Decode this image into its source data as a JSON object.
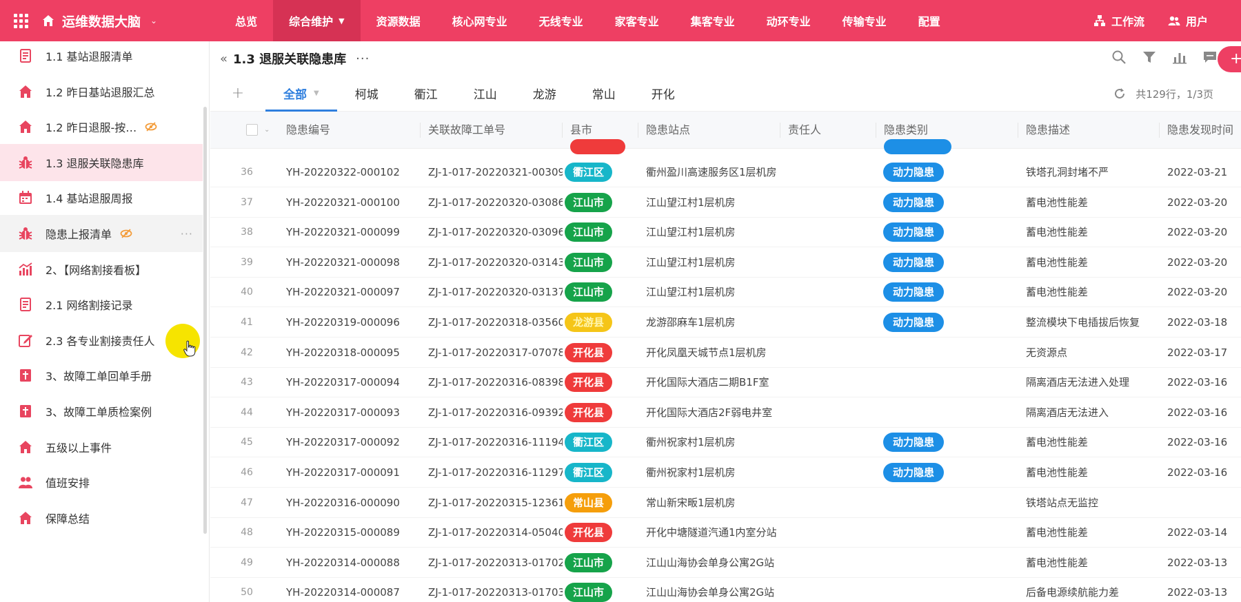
{
  "topbar": {
    "app_title": "运维数据大脑",
    "nav": [
      {
        "label": "总览",
        "active": false,
        "dropdown": false
      },
      {
        "label": "综合维护",
        "active": true,
        "dropdown": true
      },
      {
        "label": "资源数据",
        "active": false,
        "dropdown": false
      },
      {
        "label": "核心网专业",
        "active": false,
        "dropdown": false
      },
      {
        "label": "无线专业",
        "active": false,
        "dropdown": false
      },
      {
        "label": "家客专业",
        "active": false,
        "dropdown": false
      },
      {
        "label": "集客专业",
        "active": false,
        "dropdown": false
      },
      {
        "label": "动环专业",
        "active": false,
        "dropdown": false
      },
      {
        "label": "传输专业",
        "active": false,
        "dropdown": false
      },
      {
        "label": "配置",
        "active": false,
        "dropdown": false
      }
    ],
    "workflow_label": "工作流",
    "user_label": "用户",
    "brand_color": "#ee3f63"
  },
  "sidebar": {
    "items": [
      {
        "label": "1.1 基站退服清单",
        "icon": "report-icon",
        "state": "normal",
        "hidden": false
      },
      {
        "label": "1.2 昨日基站退服汇总",
        "icon": "home-icon",
        "state": "normal",
        "hidden": false
      },
      {
        "label": "1.2 昨日退服-按…",
        "icon": "home-icon",
        "state": "normal",
        "hidden": true
      },
      {
        "label": "1.3 退服关联隐患库",
        "icon": "bug-icon",
        "state": "active",
        "hidden": false
      },
      {
        "label": "1.4 基站退服周报",
        "icon": "calendar-icon",
        "state": "normal",
        "hidden": false
      },
      {
        "label": "隐患上报清单",
        "icon": "bug-icon",
        "state": "hover",
        "hidden": true
      },
      {
        "label": "2、【网络割接看板】",
        "icon": "bar-chart-icon",
        "state": "normal",
        "hidden": false
      },
      {
        "label": "2.1 网络割接记录",
        "icon": "report-icon",
        "state": "normal",
        "hidden": false
      },
      {
        "label": "2.3 各专业割接责任人",
        "icon": "edit-icon",
        "state": "normal",
        "hidden": false
      },
      {
        "label": "3、故障工单回单手册",
        "icon": "book-icon",
        "state": "normal",
        "hidden": false
      },
      {
        "label": "3、故障工单质检案例",
        "icon": "book-icon",
        "state": "normal",
        "hidden": false
      },
      {
        "label": "五级以上事件",
        "icon": "home-icon",
        "state": "normal",
        "hidden": false
      },
      {
        "label": "值班安排",
        "icon": "users-icon",
        "state": "normal",
        "hidden": false
      },
      {
        "label": "保障总结",
        "icon": "home-icon",
        "state": "normal",
        "hidden": false
      }
    ]
  },
  "page": {
    "title": "1.3 退服关联隐患库",
    "tabs": [
      {
        "label": "全部",
        "active": true
      },
      {
        "label": "柯城",
        "active": false
      },
      {
        "label": "衢江",
        "active": false
      },
      {
        "label": "江山",
        "active": false
      },
      {
        "label": "龙游",
        "active": false
      },
      {
        "label": "常山",
        "active": false
      },
      {
        "label": "开化",
        "active": false
      }
    ],
    "pager_text": "共129行，1/3页"
  },
  "table": {
    "columns": [
      "隐患编号",
      "关联故障工单号",
      "县市",
      "隐患站点",
      "责任人",
      "隐患类别",
      "隐患描述",
      "隐患发现时间"
    ],
    "county_colors": {
      "衢江区": "#17b6c9",
      "江山市": "#16a34a",
      "龙游县": "#f5c518",
      "开化县": "#ef3b3b",
      "常山县": "#f59e0b"
    },
    "rows": [
      {
        "idx": "36",
        "id": "YH-20220322-000102",
        "order": "ZJ-1-017-20220321-00309",
        "county": "衢江区",
        "site": "衢州盈川高速服务区1层机房",
        "owner": "",
        "category": "动力隐患",
        "desc": "铁塔孔洞封堵不严",
        "date": "2022-03-21"
      },
      {
        "idx": "37",
        "id": "YH-20220321-000100",
        "order": "ZJ-1-017-20220320-03086",
        "county": "江山市",
        "site": "江山望江村1层机房",
        "owner": "",
        "category": "动力隐患",
        "desc": "蓄电池性能差",
        "date": "2022-03-20"
      },
      {
        "idx": "38",
        "id": "YH-20220321-000099",
        "order": "ZJ-1-017-20220320-03096",
        "county": "江山市",
        "site": "江山望江村1层机房",
        "owner": "",
        "category": "动力隐患",
        "desc": "蓄电池性能差",
        "date": "2022-03-20"
      },
      {
        "idx": "39",
        "id": "YH-20220321-000098",
        "order": "ZJ-1-017-20220320-03143",
        "county": "江山市",
        "site": "江山望江村1层机房",
        "owner": "",
        "category": "动力隐患",
        "desc": "蓄电池性能差",
        "date": "2022-03-20"
      },
      {
        "idx": "40",
        "id": "YH-20220321-000097",
        "order": "ZJ-1-017-20220320-03137",
        "county": "江山市",
        "site": "江山望江村1层机房",
        "owner": "",
        "category": "动力隐患",
        "desc": "蓄电池性能差",
        "date": "2022-03-20"
      },
      {
        "idx": "41",
        "id": "YH-20220319-000096",
        "order": "ZJ-1-017-20220318-03560",
        "county": "龙游县",
        "site": "龙游邵麻车1层机房",
        "owner": "",
        "category": "动力隐患",
        "desc": "整流模块下电插拔后恢复",
        "date": "2022-03-18"
      },
      {
        "idx": "42",
        "id": "YH-20220318-000095",
        "order": "ZJ-1-017-20220317-07078",
        "county": "开化县",
        "site": "开化凤凰天城节点1层机房",
        "owner": "",
        "category": "",
        "desc": "无资源点",
        "date": "2022-03-17"
      },
      {
        "idx": "43",
        "id": "YH-20220317-000094",
        "order": "ZJ-1-017-20220316-08398",
        "county": "开化县",
        "site": "开化国际大酒店二期B1F室",
        "owner": "",
        "category": "",
        "desc": "隔离酒店无法进入处理",
        "date": "2022-03-16"
      },
      {
        "idx": "44",
        "id": "YH-20220317-000093",
        "order": "ZJ-1-017-20220316-09392",
        "county": "开化县",
        "site": "开化国际大酒店2F弱电井室",
        "owner": "",
        "category": "",
        "desc": "隔离酒店无法进入",
        "date": "2022-03-16"
      },
      {
        "idx": "45",
        "id": "YH-20220317-000092",
        "order": "ZJ-1-017-20220316-11194",
        "county": "衢江区",
        "site": "衢州祝家村1层机房",
        "owner": "",
        "category": "动力隐患",
        "desc": "蓄电池性能差",
        "date": "2022-03-16"
      },
      {
        "idx": "46",
        "id": "YH-20220317-000091",
        "order": "ZJ-1-017-20220316-11297",
        "county": "衢江区",
        "site": "衢州祝家村1层机房",
        "owner": "",
        "category": "动力隐患",
        "desc": "蓄电池性能差",
        "date": "2022-03-16"
      },
      {
        "idx": "47",
        "id": "YH-20220316-000090",
        "order": "ZJ-1-017-20220315-12361",
        "county": "常山县",
        "site": "常山新宋畈1层机房",
        "owner": "",
        "category": "",
        "desc": "铁塔站点无监控",
        "date": ""
      },
      {
        "idx": "48",
        "id": "YH-20220315-000089",
        "order": "ZJ-1-017-20220314-05040",
        "county": "开化县",
        "site": "开化中塘隧道汽通1内室分站",
        "owner": "",
        "category": "",
        "desc": "蓄电池性能差",
        "date": "2022-03-14"
      },
      {
        "idx": "49",
        "id": "YH-20220314-000088",
        "order": "ZJ-1-017-20220313-01702",
        "county": "江山市",
        "site": "江山山海协会单身公寓2G站",
        "owner": "",
        "category": "",
        "desc": "蓄电池性能差",
        "date": "2022-03-13"
      },
      {
        "idx": "50",
        "id": "YH-20220314-000087",
        "order": "ZJ-1-017-20220313-01703",
        "county": "江山市",
        "site": "江山山海协会单身公寓2G站",
        "owner": "",
        "category": "",
        "desc": "后备电源续航能力差",
        "date": "2022-03-13"
      }
    ]
  }
}
